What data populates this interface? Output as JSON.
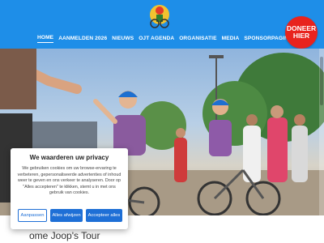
{
  "header": {
    "logo_icon": "bicycle-mascot-logo-icon",
    "nav": [
      {
        "label": "HOME",
        "active": true
      },
      {
        "label": "AANMELDEN 2026"
      },
      {
        "label": "NIEUWS"
      },
      {
        "label": "OJT AGENDA"
      },
      {
        "label": "ORGANISATIE"
      },
      {
        "label": "MEDIA"
      },
      {
        "label": "SPONSORPAGINA"
      }
    ],
    "donate_label": "DONEER HIER",
    "bar_color": "#1e8ee8",
    "donate_color": "#e8231d"
  },
  "hero": {
    "title": "ome Joop's Tour"
  },
  "cookie": {
    "title": "We waarderen uw privacy",
    "text": "We gebruiken cookies om uw browse-ervaring te verbeteren, gepersonaliseerde advertenties of inhoud weer te geven en ons verkeer te analyseren. Door op \"Alles accepteren\" te klikken, stemt u in met ons gebruik van cookies.",
    "buttons": {
      "customize": "Aanpassen",
      "reject": "Alles afwijzen",
      "accept": "Accepteer alles"
    },
    "button_color": "#1e6fd6"
  }
}
